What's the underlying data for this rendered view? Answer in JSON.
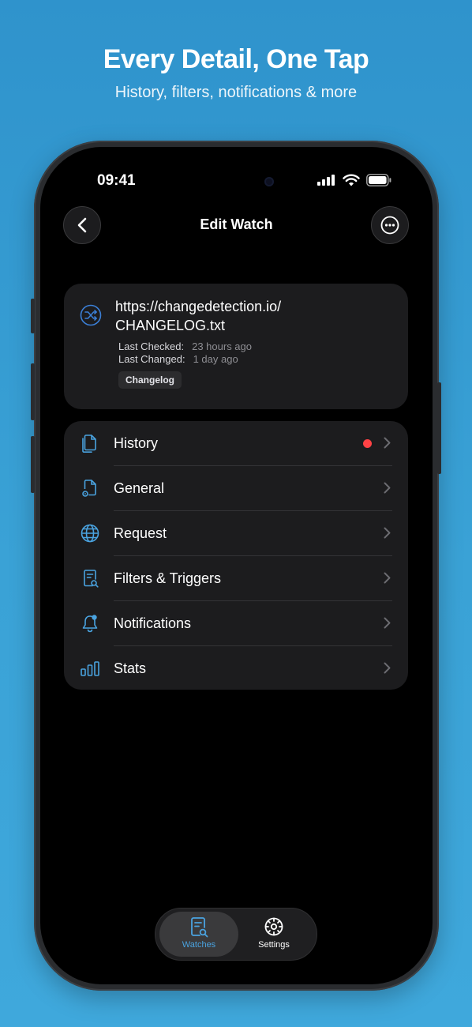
{
  "promo": {
    "headline": "Every Detail, One Tap",
    "subline": "History, filters, notifications & more"
  },
  "status_bar": {
    "time": "09:41"
  },
  "nav": {
    "title": "Edit Watch",
    "back_icon": "chevron-left-icon",
    "more_icon": "ellipsis-circle-icon"
  },
  "watch": {
    "url_line1": "https://changedetection.io/",
    "url_line2": "CHANGELOG.txt",
    "last_checked_label": "Last Checked:",
    "last_checked_value": "23 hours ago",
    "last_changed_label": "Last Changed:",
    "last_changed_value": "1 day ago",
    "tag": "Changelog"
  },
  "menu": {
    "items": [
      {
        "label": "History",
        "icon": "document-history-icon",
        "has_dot": true
      },
      {
        "label": "General",
        "icon": "document-gear-icon"
      },
      {
        "label": "Request",
        "icon": "globe-icon"
      },
      {
        "label": "Filters & Triggers",
        "icon": "document-search-icon"
      },
      {
        "label": "Notifications",
        "icon": "bell-icon"
      },
      {
        "label": "Stats",
        "icon": "bar-chart-icon"
      }
    ]
  },
  "tabbar": {
    "tabs": [
      {
        "label": "Watches",
        "icon": "document-search-icon",
        "active": true
      },
      {
        "label": "Settings",
        "icon": "gear-icon",
        "active": false
      }
    ]
  },
  "colors": {
    "accent": "#4aa3e0",
    "badge_red": "#ff4245",
    "card_bg": "#1c1c1e",
    "page_bg": "#3aa2d6"
  }
}
